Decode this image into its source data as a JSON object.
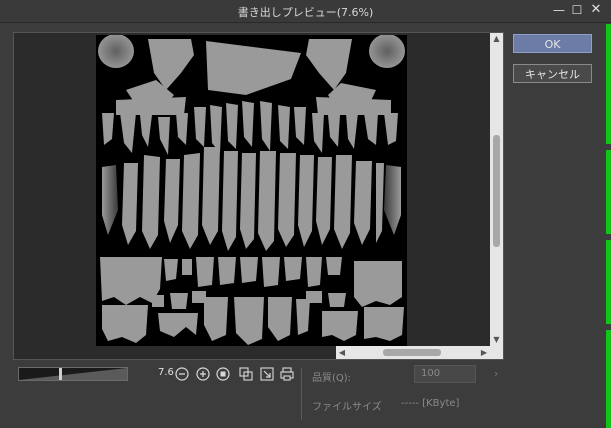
{
  "window": {
    "title": "書き出しプレビュー(7.6%)",
    "minimize_glyph": "—",
    "maximize_glyph": "☐",
    "close_glyph": "✕"
  },
  "buttons": {
    "ok_label": "OK",
    "cancel_label": "キャンセル"
  },
  "scrollbars": {
    "up_glyph": "▲",
    "down_glyph": "▼",
    "left_glyph": "◀",
    "right_glyph": "▶"
  },
  "zoom": {
    "value": "7.6",
    "slider_level_fraction": 0.38
  },
  "quality": {
    "label": "品質(Q):",
    "value": "100",
    "arrow_glyph": "›"
  },
  "filesize": {
    "label": "ファイルサイズ",
    "value": "----- [KByte]"
  },
  "icons": {
    "zoom_out": "zoom-out-icon",
    "zoom_in": "zoom-in-icon",
    "stop": "stop-icon",
    "actual_size": "actual-size-icon",
    "fit": "fit-window-icon",
    "print_size": "print-size-icon"
  },
  "colors": {
    "accent_button": "#6c7ca6",
    "texture_gray": "#9a9a9a",
    "edge_green": "#12c41a"
  }
}
